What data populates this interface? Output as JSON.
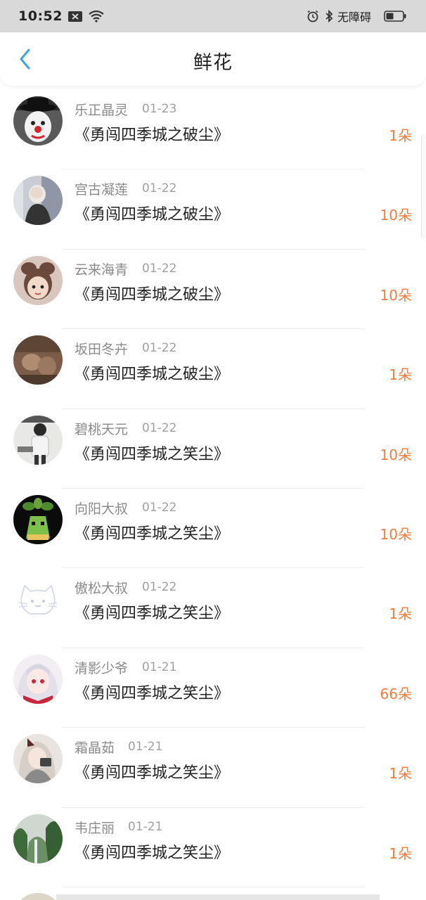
{
  "status_bar": {
    "time": "10:52",
    "accessibility": "无障碍"
  },
  "header": {
    "title": "鲜花"
  },
  "accent_color": "#f07d3c",
  "items": [
    {
      "name": "乐正晶灵",
      "date": "01-23",
      "title": "《勇闯四季城之破尘》",
      "count": "1朵",
      "avatar": "clown"
    },
    {
      "name": "宫古凝莲",
      "date": "01-22",
      "title": "《勇闯四季城之破尘》",
      "count": "10朵",
      "avatar": "person-photo"
    },
    {
      "name": "云来海青",
      "date": "01-22",
      "title": "《勇闯四季城之破尘》",
      "count": "10朵",
      "avatar": "child-photo"
    },
    {
      "name": "坂田冬卉",
      "date": "01-22",
      "title": "《勇闯四季城之破尘》",
      "count": "1朵",
      "avatar": "brown-photo"
    },
    {
      "name": "碧桃天元",
      "date": "01-22",
      "title": "《勇闯四季城之笑尘》",
      "count": "10朵",
      "avatar": "man-photo"
    },
    {
      "name": "向阳大叔",
      "date": "01-22",
      "title": "《勇闯四季城之笑尘》",
      "count": "10朵",
      "avatar": "pixel-plant"
    },
    {
      "name": "傲松大叔",
      "date": "01-22",
      "title": "《勇闯四季城之笑尘》",
      "count": "1朵",
      "avatar": "cat-default"
    },
    {
      "name": "清影少爷",
      "date": "01-21",
      "title": "《勇闯四季城之笑尘》",
      "count": "66朵",
      "avatar": "anime-girl"
    },
    {
      "name": "霜晶茹",
      "date": "01-21",
      "title": "《勇闯四季城之笑尘》",
      "count": "1朵",
      "avatar": "girl-photo"
    },
    {
      "name": "韦庄丽",
      "date": "01-21",
      "title": "《勇闯四季城之笑尘》",
      "count": "1朵",
      "avatar": "landscape"
    }
  ]
}
